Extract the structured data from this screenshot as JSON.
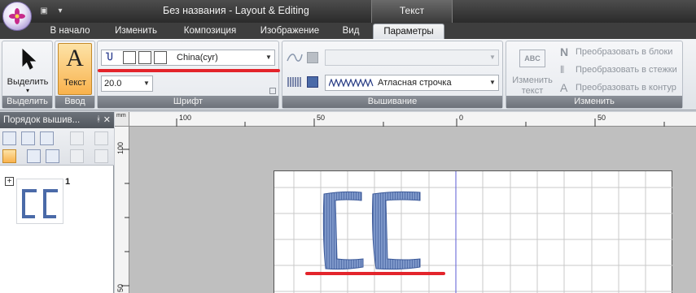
{
  "window": {
    "title": "Без названия - Layout & Editing",
    "context_tab_group": "Текст"
  },
  "tabs": [
    "В начало",
    "Изменить",
    "Композиция",
    "Изображение",
    "Вид",
    "Параметры"
  ],
  "ribbon": {
    "select_group": {
      "button_label": "Выделить",
      "group_label": "Выделить"
    },
    "input_group": {
      "button_label": "Текст",
      "button_glyph": "A",
      "group_label": "Ввод"
    },
    "font_group": {
      "font_name": "China(cyr)",
      "font_size": "20.0",
      "group_label": "Шрифт"
    },
    "embroidery_group": {
      "stitch_type": "Атласная строчка",
      "group_label": "Вышивание"
    },
    "modify_group": {
      "change_text_label_1": "Изменить",
      "change_text_label_2": "текст",
      "abc_badge": "ABC",
      "convert_blocks": "Преобразовать в блоки",
      "convert_stitches": "Преобразовать в стежки",
      "convert_outline": "Преобразовать в контур",
      "group_label": "Изменить"
    }
  },
  "left_panel": {
    "title": "Порядок вышив...",
    "item_number": "1",
    "expand_symbol": "+"
  },
  "ruler": {
    "unit": "mm",
    "top_labels": [
      "100",
      "50",
      "0",
      "50"
    ],
    "left_labels": [
      "100",
      "50"
    ]
  },
  "colors": {
    "accent_red": "#e3242b",
    "stitch_blue": "#4a6aa8",
    "ribbon_active_orange": "#f9b24d"
  }
}
